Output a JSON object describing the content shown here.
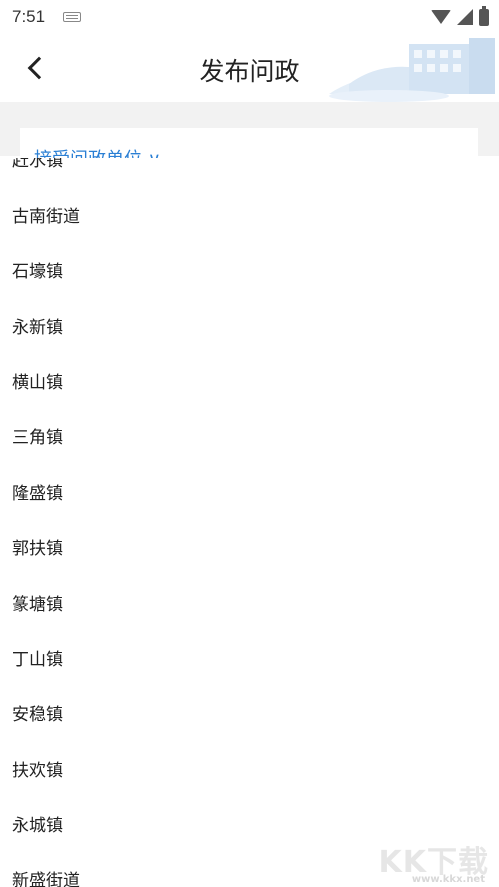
{
  "status_bar": {
    "time": "7:51",
    "icons": [
      "keyboard-icon",
      "wifi-icon",
      "signal-icon",
      "battery-icon"
    ]
  },
  "header": {
    "back_icon": "chevron-left-icon",
    "title": "发布问政"
  },
  "tab": {
    "label": "接受问政单位 ∨",
    "color": "#2a7fd4"
  },
  "list": {
    "clipped_item": "赶水镇",
    "items": [
      "古南街道",
      "石壕镇",
      "永新镇",
      "横山镇",
      "三角镇",
      "隆盛镇",
      "郭扶镇",
      "篆塘镇",
      "丁山镇",
      "安稳镇",
      "扶欢镇",
      "永城镇",
      "新盛街道"
    ]
  },
  "watermark": {
    "logo": "KK下载",
    "url": "www.kkx.net"
  }
}
